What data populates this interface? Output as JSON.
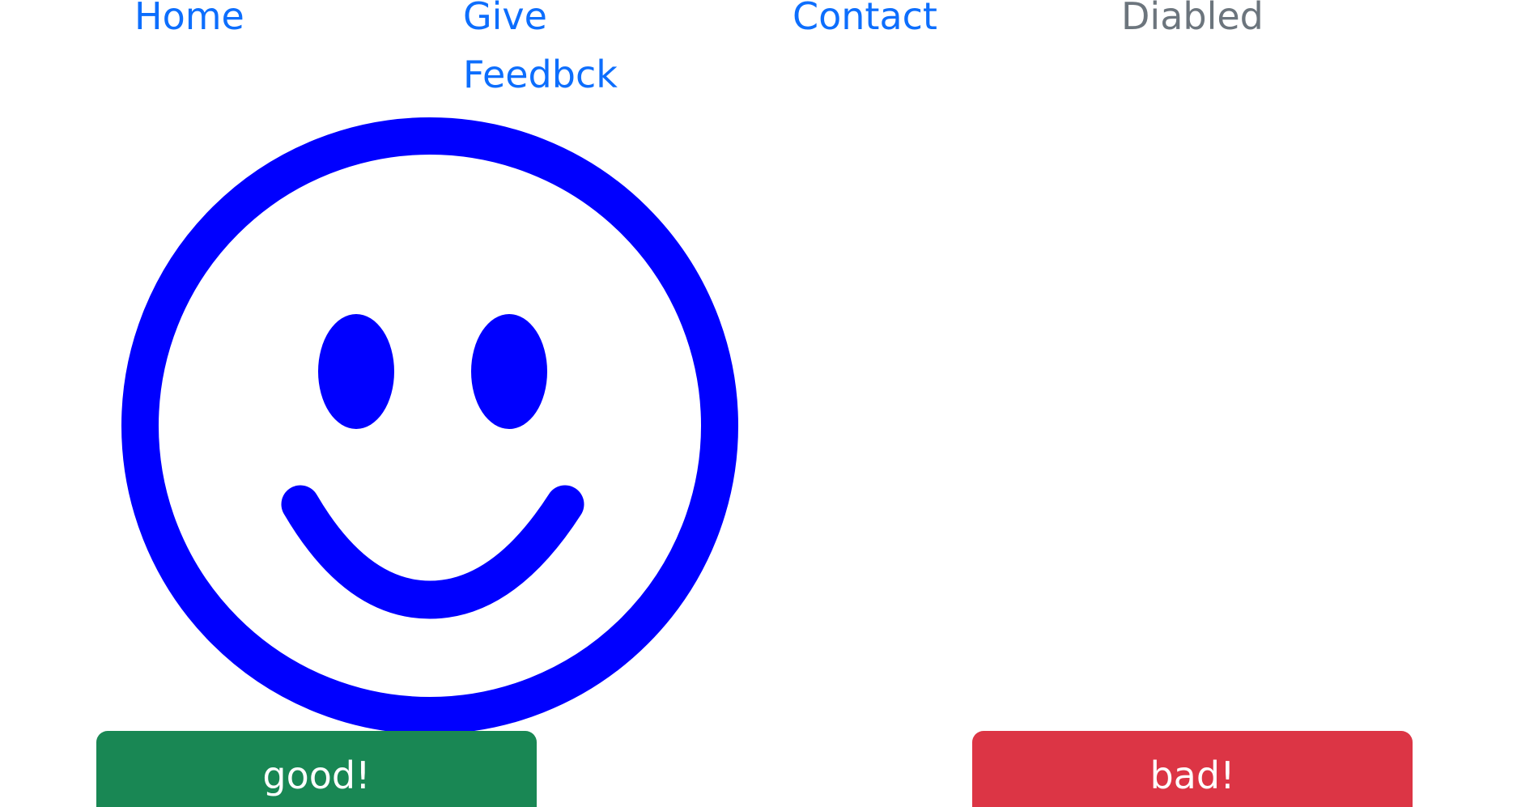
{
  "nav": {
    "home_label": "Home",
    "feedback_label": "Give Feedbck",
    "contact_label": "Contact",
    "disabled_label": "Diabled"
  },
  "buttons": {
    "good_label": "good!",
    "bad_label": "bad!"
  },
  "colors": {
    "link": "#0d6efd",
    "link_disabled": "#6c757d",
    "smiley": "#0000ff",
    "good": "#198754",
    "bad": "#dc3545"
  },
  "icons": {
    "face": "smiley-face-icon"
  }
}
